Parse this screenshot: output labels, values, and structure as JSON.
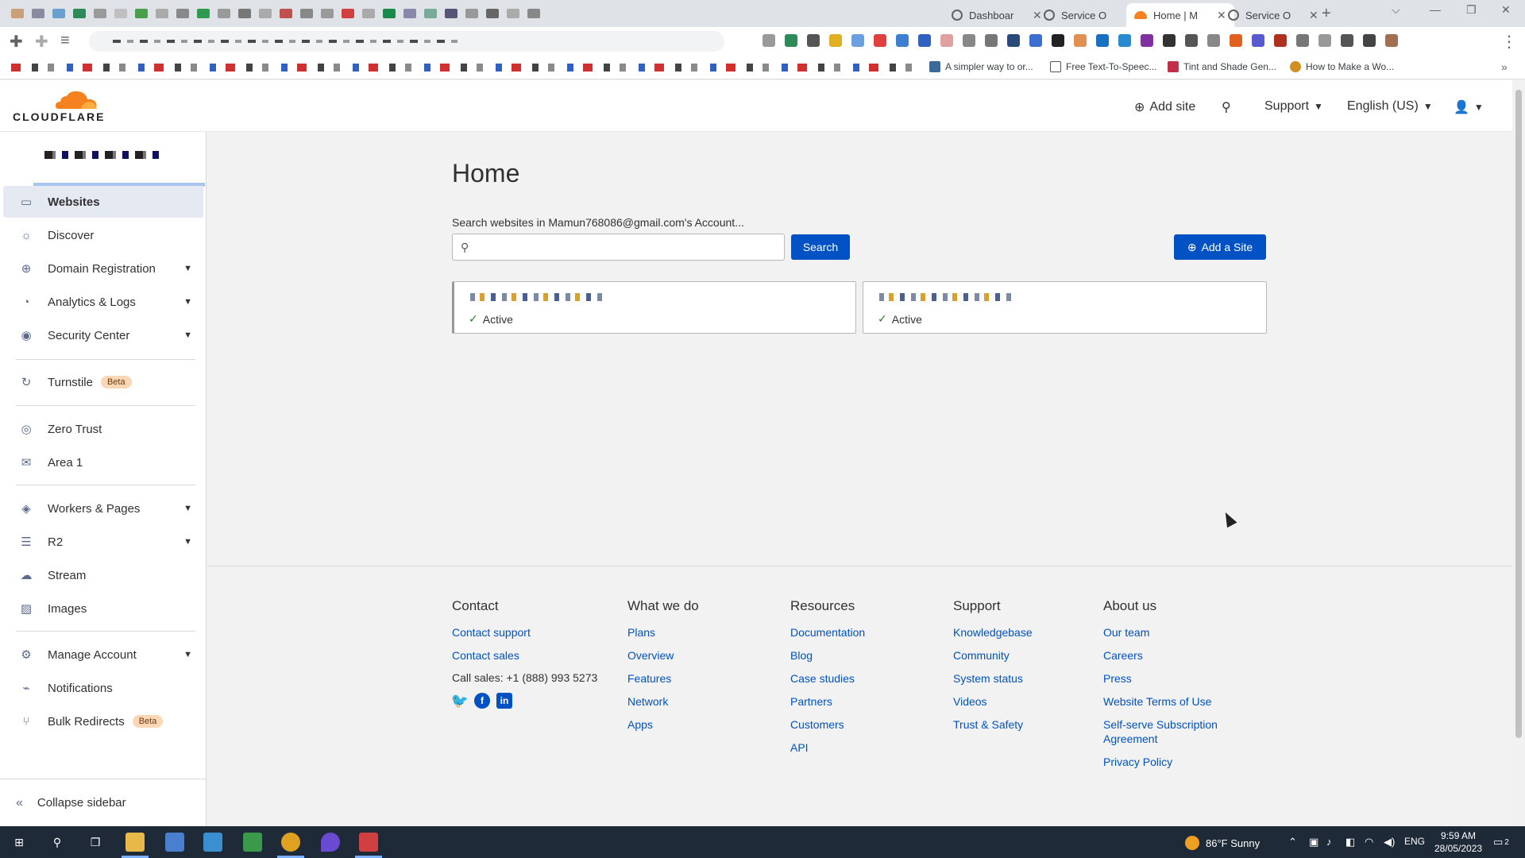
{
  "browser": {
    "tabs": [
      {
        "title": "Dashboar",
        "active": false
      },
      {
        "title": "Service O",
        "active": false
      },
      {
        "title": "Home | M",
        "active": true
      },
      {
        "title": "Service O",
        "active": false
      }
    ],
    "bookmarks": [
      {
        "label": "A simpler way to or..."
      },
      {
        "label": "Free Text-To-Speec..."
      },
      {
        "label": "Tint and Shade Gen..."
      },
      {
        "label": "How to Make a Wo..."
      }
    ]
  },
  "header": {
    "logo_text": "CLOUDFLARE",
    "add_site": "Add site",
    "support": "Support",
    "language": "English (US)"
  },
  "sidebar": {
    "items": [
      {
        "label": "Websites",
        "icon": "browser-window-icon",
        "active": true,
        "caret": false,
        "beta": false
      },
      {
        "label": "Discover",
        "icon": "lightbulb-icon",
        "active": false,
        "caret": false,
        "beta": false
      },
      {
        "label": "Domain Registration",
        "icon": "globe-icon",
        "active": false,
        "caret": true,
        "beta": false
      },
      {
        "label": "Analytics & Logs",
        "icon": "clock-chart-icon",
        "active": false,
        "caret": true,
        "beta": false
      },
      {
        "label": "Security Center",
        "icon": "shield-target-icon",
        "active": false,
        "caret": true,
        "beta": false
      },
      {
        "label": "Turnstile",
        "icon": "turnstile-icon",
        "active": false,
        "caret": false,
        "beta": true
      },
      {
        "label": "Zero Trust",
        "icon": "zero-trust-icon",
        "active": false,
        "caret": false,
        "beta": false
      },
      {
        "label": "Area 1",
        "icon": "envelope-icon",
        "active": false,
        "caret": false,
        "beta": false
      },
      {
        "label": "Workers & Pages",
        "icon": "workers-icon",
        "active": false,
        "caret": true,
        "beta": false
      },
      {
        "label": "R2",
        "icon": "database-icon",
        "active": false,
        "caret": true,
        "beta": false
      },
      {
        "label": "Stream",
        "icon": "stream-cloud-icon",
        "active": false,
        "caret": false,
        "beta": false
      },
      {
        "label": "Images",
        "icon": "image-icon",
        "active": false,
        "caret": false,
        "beta": false
      },
      {
        "label": "Manage Account",
        "icon": "gear-icon",
        "active": false,
        "caret": true,
        "beta": false
      },
      {
        "label": "Notifications",
        "icon": "satellite-icon",
        "active": false,
        "caret": false,
        "beta": false
      },
      {
        "label": "Bulk Redirects",
        "icon": "redirect-icon",
        "active": false,
        "caret": false,
        "beta": true
      }
    ],
    "beta_label": "Beta",
    "collapse_label": "Collapse sidebar"
  },
  "main": {
    "title": "Home",
    "search_label": "Search websites in Mamun768086@gmail.com's Account...",
    "search_value": "",
    "search_button": "Search",
    "add_site_button": "Add a Site",
    "sites": [
      {
        "status": "Active"
      },
      {
        "status": "Active"
      }
    ]
  },
  "footer": {
    "contact": {
      "heading": "Contact",
      "links": [
        "Contact support",
        "Contact sales"
      ],
      "phone": "Call sales: +1 (888) 993 5273"
    },
    "what_we_do": {
      "heading": "What we do",
      "links": [
        "Plans",
        "Overview",
        "Features",
        "Network",
        "Apps"
      ]
    },
    "resources": {
      "heading": "Resources",
      "links": [
        "Documentation",
        "Blog",
        "Case studies",
        "Partners",
        "Customers",
        "API"
      ]
    },
    "support": {
      "heading": "Support",
      "links": [
        "Knowledgebase",
        "Community",
        "System status",
        "Videos",
        "Trust & Safety"
      ]
    },
    "about": {
      "heading": "About us",
      "links": [
        "Our team",
        "Careers",
        "Press",
        "Website Terms of Use",
        "Self-serve Subscription Agreement",
        "Privacy Policy"
      ]
    }
  },
  "taskbar": {
    "weather": "86°F  Sunny",
    "language": "ENG",
    "time": "9:59 AM",
    "date": "28/05/2023",
    "notification_count": "2"
  },
  "colors": {
    "accent": "#0051c3",
    "brand_orange": "#f6821f",
    "active_nav_bg": "#e5eaf2"
  }
}
